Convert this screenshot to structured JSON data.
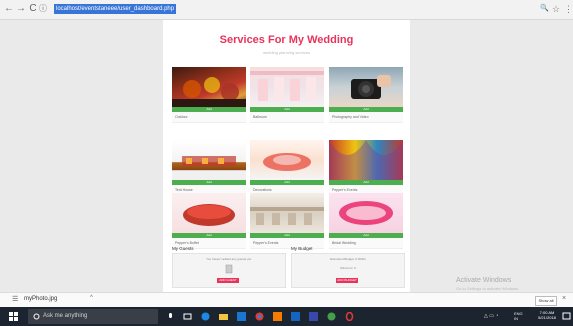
{
  "browser": {
    "url": "localhost/eventstaneee/user_dashboard.php",
    "back_glyph": "←",
    "forward_glyph": "→",
    "reload_glyph": "C",
    "info_glyph": "ⓘ",
    "zoom_glyph": "🔍",
    "star_glyph": "☆",
    "menu_glyph": "⋮"
  },
  "page": {
    "title": "Services For My Wedding",
    "subtitle": "wedding planning services",
    "services": [
      {
        "name": "Outdoor",
        "button_label": "Add",
        "photo": "catering-photo"
      },
      {
        "name": "Ballroom",
        "button_label": "Add",
        "photo": "reception-photo"
      },
      {
        "name": "Photography and Video",
        "button_label": "Add",
        "photo": "camera-photo"
      },
      {
        "name": "Tent House",
        "button_label": "Add",
        "photo": "tent-house-photo"
      },
      {
        "name": "Decorations",
        "button_label": "Add",
        "photo": "decorations-photo"
      },
      {
        "name": "Pepper's Events",
        "button_label": "Add",
        "photo": "events-photo"
      },
      {
        "name": "Pepper's Buffet",
        "button_label": "Add",
        "photo": "buffet-photo"
      },
      {
        "name": "Pepper's Events",
        "button_label": "Add",
        "photo": "events2-photo"
      },
      {
        "name": "Bridal Wedding",
        "button_label": "Add",
        "photo": "wedding-sign-photo"
      }
    ],
    "guests": {
      "heading": "My Guests",
      "text": "You haven't added any guests yet.",
      "button_label": "ADD GUEST"
    },
    "budget": {
      "heading": "My Budget",
      "text": "Estimated Budget: 0.00/Rs",
      "amount": "Minimum: 0",
      "button_label": "ADD BUDGET"
    }
  },
  "watermark": {
    "line1": "Activate Windows",
    "line2": "Go to Settings to activate Windows."
  },
  "download_bar": {
    "file_name": "myPhoto.jpg",
    "show_all_label": "Show all",
    "close_glyph": "×",
    "chevron_glyph": "^",
    "file_glyph": "☰"
  },
  "taskbar": {
    "search_placeholder": "Ask me anything",
    "language": "ENG",
    "region": "IN",
    "time": "7:00 AM",
    "date": "5/21/2018",
    "tray_glyph": "△ ▭ ◔"
  },
  "colors": {
    "accent_red": "#e8345a",
    "add_green": "#4cae4f",
    "taskbar": "#1c2430",
    "url_highlight": "#3875d7"
  }
}
